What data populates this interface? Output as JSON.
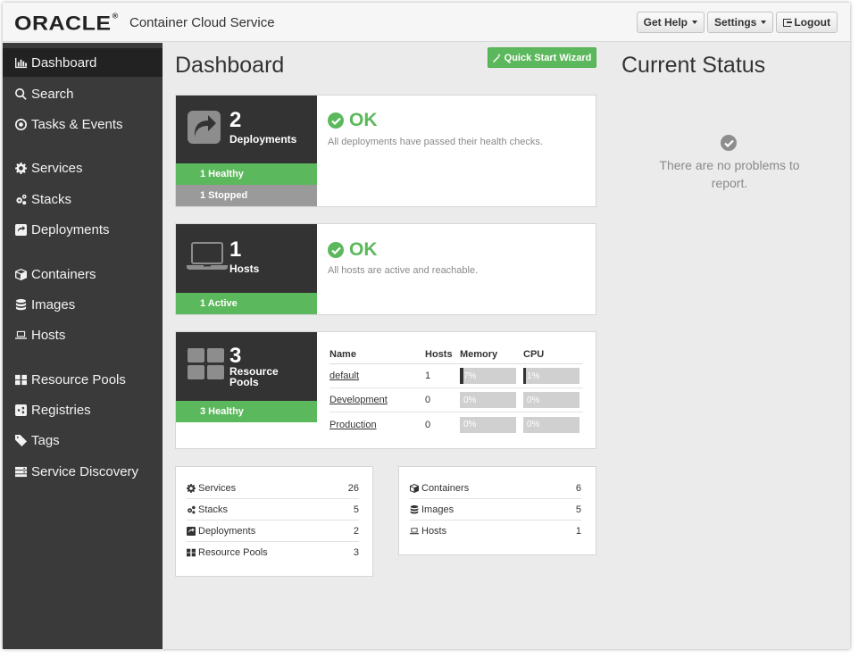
{
  "header": {
    "logo": "ORACLE",
    "product": "Container Cloud Service",
    "buttons": {
      "help": "Get Help",
      "settings": "Settings",
      "logout": "Logout"
    }
  },
  "sidebar": {
    "items": [
      {
        "label": "Dashboard",
        "icon": "bar-chart-icon",
        "active": true
      },
      {
        "label": "Search",
        "icon": "search-icon"
      },
      {
        "label": "Tasks & Events",
        "icon": "circle-dot-icon"
      },
      {
        "label": "Services",
        "icon": "gear-icon"
      },
      {
        "label": "Stacks",
        "icon": "gears-icon"
      },
      {
        "label": "Deployments",
        "icon": "share-square-icon"
      },
      {
        "label": "Containers",
        "icon": "cube-icon"
      },
      {
        "label": "Images",
        "icon": "database-icon"
      },
      {
        "label": "Hosts",
        "icon": "laptop-icon"
      },
      {
        "label": "Resource Pools",
        "icon": "grid-icon"
      },
      {
        "label": "Registries",
        "icon": "share-icon"
      },
      {
        "label": "Tags",
        "icon": "tag-icon"
      },
      {
        "label": "Service Discovery",
        "icon": "server-icon"
      }
    ]
  },
  "main": {
    "title": "Dashboard",
    "wizard_label": "Quick Start Wizard",
    "deployments": {
      "count": "2",
      "label": "Deployments",
      "bars": [
        "1 Healthy",
        "1 Stopped"
      ],
      "status": "OK",
      "desc": "All deployments have passed their health checks."
    },
    "hosts": {
      "count": "1",
      "label": "Hosts",
      "bars": [
        "1 Active"
      ],
      "status": "OK",
      "desc": "All hosts are active and reachable."
    },
    "pools": {
      "count": "3",
      "label_line1": "Resource",
      "label_line2": "Pools",
      "bars": [
        "3 Healthy"
      ],
      "columns": [
        "Name",
        "Hosts",
        "Memory",
        "CPU"
      ],
      "rows": [
        {
          "name": "default",
          "hosts": "1",
          "memory": "7%",
          "memory_value": 7,
          "cpu": "1%",
          "cpu_value": 1
        },
        {
          "name": "Development",
          "hosts": "0",
          "memory": "0%",
          "memory_value": 0,
          "cpu": "0%",
          "cpu_value": 0
        },
        {
          "name": "Production",
          "hosts": "0",
          "memory": "0%",
          "memory_value": 0,
          "cpu": "0%",
          "cpu_value": 0
        }
      ]
    },
    "summary_left": [
      {
        "label": "Services",
        "value": "26",
        "icon": "gear-icon"
      },
      {
        "label": "Stacks",
        "value": "5",
        "icon": "gears-icon"
      },
      {
        "label": "Deployments",
        "value": "2",
        "icon": "share-square-icon"
      },
      {
        "label": "Resource Pools",
        "value": "3",
        "icon": "grid-icon"
      }
    ],
    "summary_right": [
      {
        "label": "Containers",
        "value": "6",
        "icon": "cube-icon"
      },
      {
        "label": "Images",
        "value": "5",
        "icon": "database-icon"
      },
      {
        "label": "Hosts",
        "value": "1",
        "icon": "laptop-icon"
      }
    ]
  },
  "current_status": {
    "title": "Current Status",
    "message": "There are no problems to report."
  },
  "colors": {
    "accent_green": "#5cb85c",
    "sidebar": "#3a3a3a",
    "sidebar_active": "#222222"
  }
}
